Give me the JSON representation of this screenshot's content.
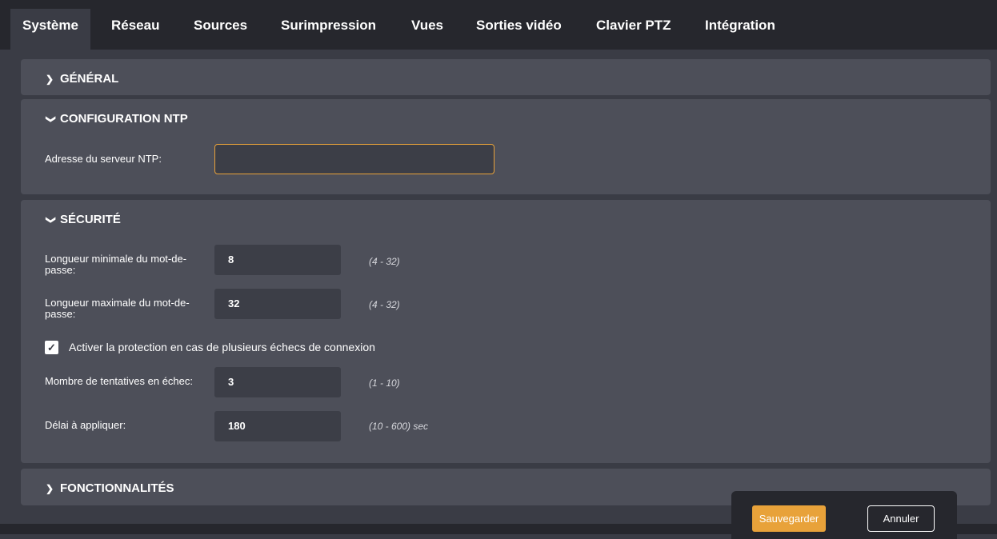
{
  "tabs": [
    {
      "label": "Système",
      "active": true
    },
    {
      "label": "Réseau"
    },
    {
      "label": "Sources"
    },
    {
      "label": "Surimpression"
    },
    {
      "label": "Vues"
    },
    {
      "label": "Sorties vidéo"
    },
    {
      "label": "Clavier PTZ"
    },
    {
      "label": "Intégration"
    }
  ],
  "sections": {
    "general": {
      "title": "GÉNÉRAL",
      "expanded": false
    },
    "ntp": {
      "title": "CONFIGURATION NTP",
      "expanded": true,
      "server_label": "Adresse du serveur NTP:",
      "server_value": ""
    },
    "security": {
      "title": "SÉCURITÉ",
      "expanded": true,
      "min_length_label": "Longueur minimale du mot-de-passe:",
      "min_length_value": "8",
      "min_length_range": "(4 - 32)",
      "max_length_label": "Longueur maximale du mot-de-passe:",
      "max_length_value": "32",
      "max_length_range": "(4 - 32)",
      "protection_label": "Activer la protection en cas de plusieurs échecs de connexion",
      "protection_checked": true,
      "attempts_label": "Mombre de tentatives en échec:",
      "attempts_value": "3",
      "attempts_range": "(1 - 10)",
      "delay_label": "Délai à appliquer:",
      "delay_value": "180",
      "delay_range": "(10 - 600) sec"
    },
    "features": {
      "title": "FONCTIONNALITÉS",
      "expanded": false
    }
  },
  "footer": {
    "save_label": "Sauvegarder",
    "cancel_label": "Annuler"
  },
  "colors": {
    "accent": "#e8a23a",
    "panel": "#4d4f59",
    "background": "#3a3c45",
    "tabbar": "#26272d"
  }
}
